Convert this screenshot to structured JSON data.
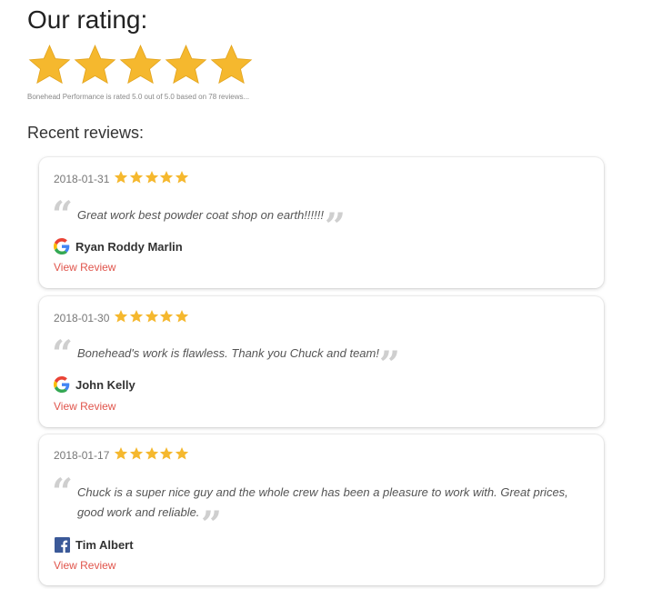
{
  "header": {
    "title": "Our rating:",
    "summary": "Bonehead Performance is rated 5.0 out of 5.0 based on 78 reviews...",
    "recent_label": "Recent reviews:"
  },
  "rating": {
    "value": 5.0,
    "max": 5.0,
    "review_count": 78,
    "stars_filled": 5
  },
  "colors": {
    "star": "#F5B82E",
    "link": "#E0544B",
    "quote": "#CFCFCF"
  },
  "reviews": [
    {
      "date": "2018-01-31",
      "stars": 5,
      "text": "Great work best powder coat shop on earth!!!!!!",
      "author": "Ryan Roddy Marlin",
      "source_icon": "google-icon",
      "link_label": "View Review"
    },
    {
      "date": "2018-01-30",
      "stars": 5,
      "text": "Bonehead's work is flawless. Thank you Chuck and team!",
      "author": "John Kelly",
      "source_icon": "google-icon",
      "link_label": "View Review"
    },
    {
      "date": "2018-01-17",
      "stars": 5,
      "text_line1": "Chuck is a super nice guy and the whole crew has been a pleasure to work with. Great prices,",
      "text_line2": "good work and reliable.",
      "author": "Tim Albert",
      "source_icon": "facebook-icon",
      "link_label": "View Review"
    }
  ]
}
